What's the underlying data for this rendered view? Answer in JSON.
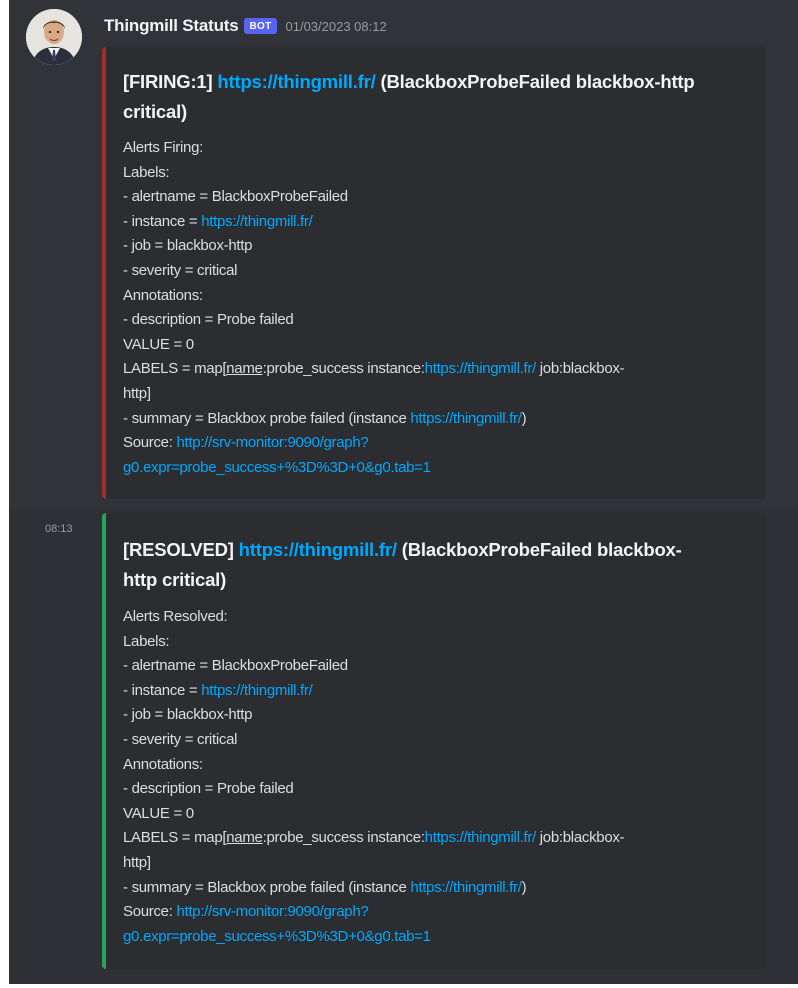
{
  "message": {
    "username": "Thingmill Statuts",
    "bot_tag": "BOT",
    "timestamp": "01/03/2023 08:12",
    "second_time": "08:13"
  },
  "colors": {
    "firing_bar": "#a12d2f",
    "resolved_bar": "#23a55a",
    "link": "#00a8fc",
    "background": "#313338",
    "embed_bg": "#2b2d31"
  },
  "embed_firing": {
    "title_prefix": "[FIRING:1]",
    "title_link": "https://thingmill.fr/",
    "title_suffix": "(BlackboxProbeFailed blackbox-http",
    "title_line2": "critical)",
    "lines": {
      "alerts_header": "Alerts Firing:",
      "labels_header": "Labels:",
      "alertname": "- alertname = BlackboxProbeFailed",
      "instance_prefix": "- instance = ",
      "instance_link": "https://thingmill.fr/",
      "job": "- job = blackbox-http",
      "severity": "- severity = critical",
      "annotations_header": "Annotations:",
      "description": "- description = Probe failed",
      "value": "VALUE = 0",
      "labels_map_prefix": "LABELS = map[",
      "labels_map_name": "name",
      "labels_map_mid": ":probe_success instance:",
      "labels_map_link": "https://thingmill.fr/",
      "labels_map_suffix": " job:blackbox-",
      "labels_map_line2": "http]",
      "summary_prefix": "- summary = Blackbox probe failed (instance ",
      "summary_link": "https://thingmill.fr/",
      "summary_suffix": ")",
      "source_prefix": "Source: ",
      "source_link_line1": "http://srv-monitor:9090/graph?",
      "source_link_line2": "g0.expr=probe_success+%3D%3D+0&g0.tab=1"
    }
  },
  "embed_resolved": {
    "title_prefix": "[RESOLVED]",
    "title_link": "https://thingmill.fr/",
    "title_suffix": "(BlackboxProbeFailed blackbox-",
    "title_line2": "http critical)",
    "lines": {
      "alerts_header": "Alerts Resolved:",
      "labels_header": "Labels:",
      "alertname": "- alertname = BlackboxProbeFailed",
      "instance_prefix": "- instance = ",
      "instance_link": "https://thingmill.fr/",
      "job": "- job = blackbox-http",
      "severity": "- severity = critical",
      "annotations_header": "Annotations:",
      "description": "- description = Probe failed",
      "value": "VALUE = 0",
      "labels_map_prefix": "LABELS = map[",
      "labels_map_name": "name",
      "labels_map_mid": ":probe_success instance:",
      "labels_map_link": "https://thingmill.fr/",
      "labels_map_suffix": " job:blackbox-",
      "labels_map_line2": "http]",
      "summary_prefix": "- summary = Blackbox probe failed (instance ",
      "summary_link": "https://thingmill.fr/",
      "summary_suffix": ")",
      "source_prefix": "Source: ",
      "source_link_line1": "http://srv-monitor:9090/graph?",
      "source_link_line2": "g0.expr=probe_success+%3D%3D+0&g0.tab=1"
    }
  }
}
